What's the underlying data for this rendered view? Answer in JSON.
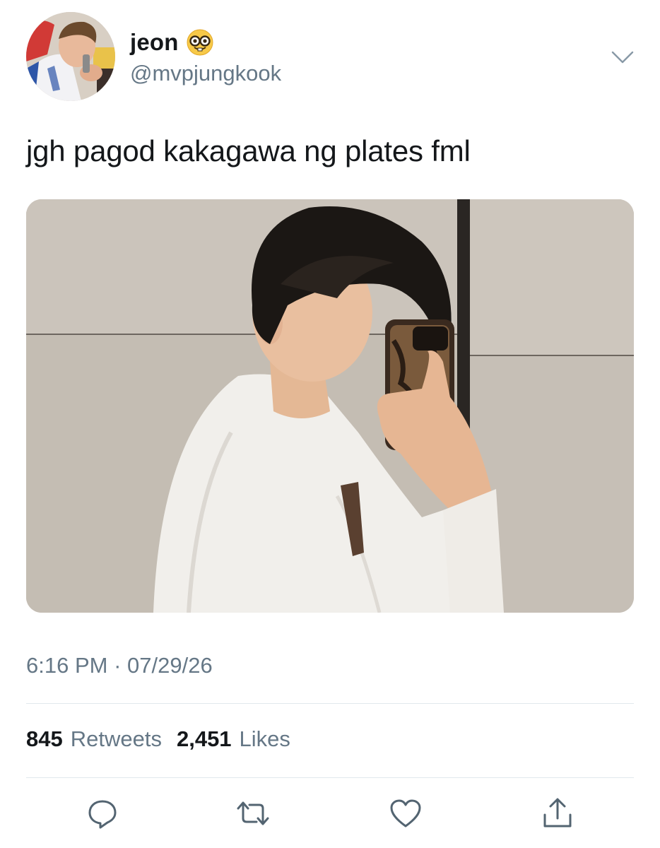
{
  "author": {
    "display_name": "jeon",
    "emoji_icon": "nerd-face-emoji",
    "handle": "@mvpjungkook"
  },
  "tweet": {
    "text": "jgh pagod kakagawa ng plates fml",
    "time": "6:16 PM",
    "separator": "·",
    "date": "07/29/26"
  },
  "stats": {
    "retweets_count": "845",
    "retweets_label": "Retweets",
    "likes_count": "2,451",
    "likes_label": "Likes"
  },
  "actions": {
    "reply_icon": "reply-icon",
    "retweet_icon": "retweet-icon",
    "like_icon": "heart-icon",
    "share_icon": "share-icon"
  },
  "colors": {
    "text_primary": "#14171a",
    "text_secondary": "#657786",
    "icon": "#536471",
    "divider": "#e1e8ed"
  }
}
